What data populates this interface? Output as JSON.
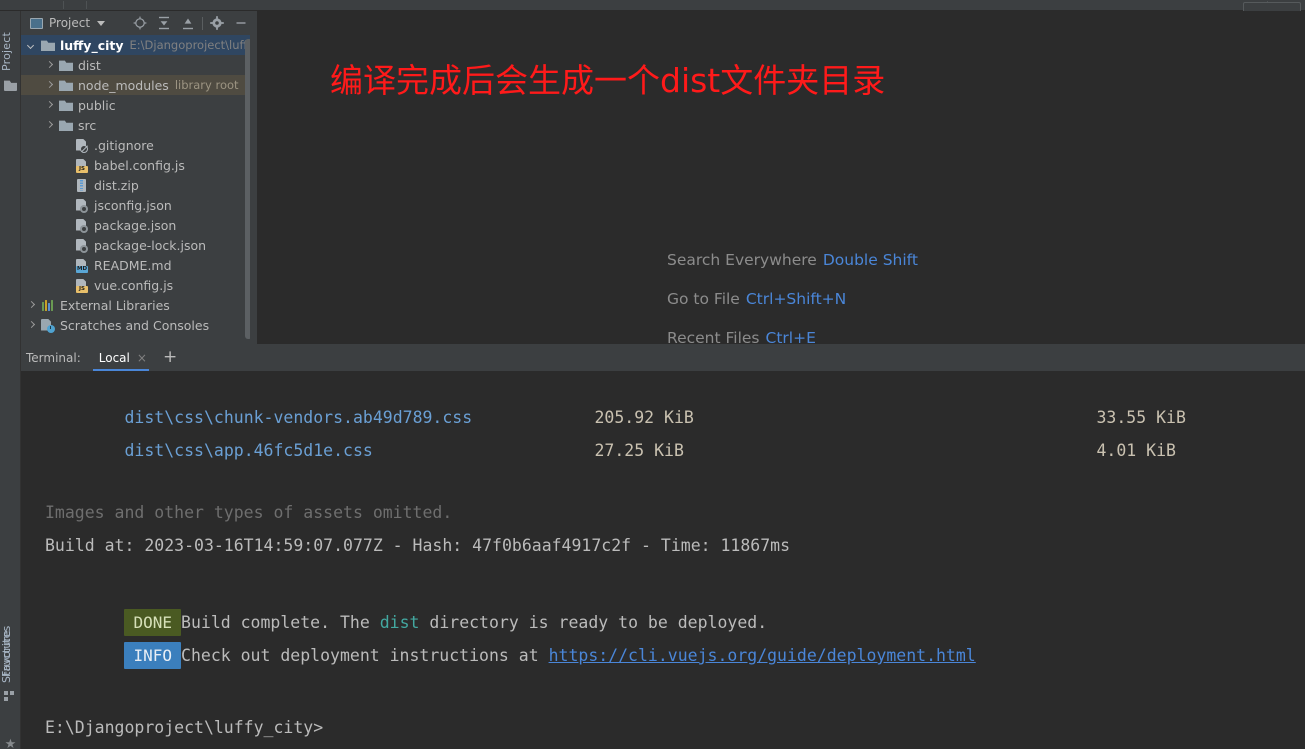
{
  "window": {
    "background": "#2b2b2b",
    "panel_background": "#3c3f41"
  },
  "rail": {
    "project_label": "Project",
    "structure_label": "Structure",
    "favorites_label": "Favorites"
  },
  "project_panel": {
    "title": "Project",
    "tools": [
      {
        "name": "locate-icon",
        "label": "Select Opened File"
      },
      {
        "name": "expand-all-icon",
        "label": "Expand All"
      },
      {
        "name": "collapse-all-icon",
        "label": "Collapse All"
      },
      {
        "name": "gear-icon",
        "label": "Settings"
      },
      {
        "name": "minimize-icon",
        "label": "Hide"
      }
    ],
    "tree": [
      {
        "name": "luffy_city",
        "sub": "E:\\Djangoproject\\luffy_",
        "icon": "folder",
        "arrow": "down",
        "indent": 6,
        "state": "selected",
        "bold": true
      },
      {
        "name": "dist",
        "sub": "",
        "icon": "folder",
        "arrow": "right",
        "indent": 24,
        "state": "normal",
        "bold": false
      },
      {
        "name": "node_modules",
        "sub": "library root",
        "icon": "folder",
        "arrow": "right",
        "indent": 24,
        "state": "highlight",
        "bold": false
      },
      {
        "name": "public",
        "sub": "",
        "icon": "folder",
        "arrow": "right",
        "indent": 24,
        "state": "normal",
        "bold": false
      },
      {
        "name": "src",
        "sub": "",
        "icon": "folder",
        "arrow": "right",
        "indent": 24,
        "state": "normal",
        "bold": false
      },
      {
        "name": ".gitignore",
        "sub": "",
        "icon": "gitignore",
        "arrow": "none",
        "indent": 40,
        "state": "normal",
        "bold": false
      },
      {
        "name": "babel.config.js",
        "sub": "",
        "icon": "js",
        "arrow": "none",
        "indent": 40,
        "state": "normal",
        "bold": false
      },
      {
        "name": "dist.zip",
        "sub": "",
        "icon": "zip",
        "arrow": "none",
        "indent": 40,
        "state": "normal",
        "bold": false
      },
      {
        "name": "jsconfig.json",
        "sub": "",
        "icon": "json",
        "arrow": "none",
        "indent": 40,
        "state": "normal",
        "bold": false
      },
      {
        "name": "package.json",
        "sub": "",
        "icon": "json",
        "arrow": "none",
        "indent": 40,
        "state": "normal",
        "bold": false
      },
      {
        "name": "package-lock.json",
        "sub": "",
        "icon": "json",
        "arrow": "none",
        "indent": 40,
        "state": "normal",
        "bold": false
      },
      {
        "name": "README.md",
        "sub": "",
        "icon": "md",
        "arrow": "none",
        "indent": 40,
        "state": "normal",
        "bold": false
      },
      {
        "name": "vue.config.js",
        "sub": "",
        "icon": "js",
        "arrow": "none",
        "indent": 40,
        "state": "normal",
        "bold": false
      },
      {
        "name": "External Libraries",
        "sub": "",
        "icon": "library",
        "arrow": "right",
        "indent": 6,
        "state": "normal",
        "bold": false
      },
      {
        "name": "Scratches and Consoles",
        "sub": "",
        "icon": "scratch",
        "arrow": "right",
        "indent": 6,
        "state": "normal",
        "bold": false
      }
    ]
  },
  "editor": {
    "annotation_text": "编译完成后会生成一个dist文件夹目录",
    "annotation_color": "#ff1a1a",
    "hints": [
      {
        "label": "Search Everywhere",
        "key": "Double Shift"
      },
      {
        "label": "Go to File",
        "key": "Ctrl+Shift+N"
      },
      {
        "label": "Recent Files",
        "key": "Ctrl+E"
      }
    ]
  },
  "terminal": {
    "label": "Terminal:",
    "tabs": [
      {
        "name": "Local",
        "close": "×",
        "active": true
      }
    ],
    "add_label": "+",
    "lines": [
      {
        "type": "asset",
        "path": "dist\\css\\chunk-vendors.ab49d789.css",
        "size": "205.92 KiB",
        "gzip": "33.55 KiB"
      },
      {
        "type": "asset",
        "path": "dist\\css\\app.46fc5d1e.css",
        "size": "27.25 KiB",
        "gzip": "4.01 KiB"
      }
    ],
    "omitted_note": "Images and other types of assets omitted.",
    "build_line": "Build at: 2023-03-16T14:59:07.077Z - Hash: 47f0b6aaf4917c2f - Time: 11867ms",
    "done": {
      "tag": "DONE",
      "text_before": "Build complete. The ",
      "highlight": "dist",
      "text_after": " directory is ready to be deployed."
    },
    "info": {
      "tag": "INFO",
      "text": "Check out deployment instructions at ",
      "link": "https://cli.vuejs.org/guide/deployment.html"
    },
    "prompt": "E:\\Djangoproject\\luffy_city>"
  }
}
